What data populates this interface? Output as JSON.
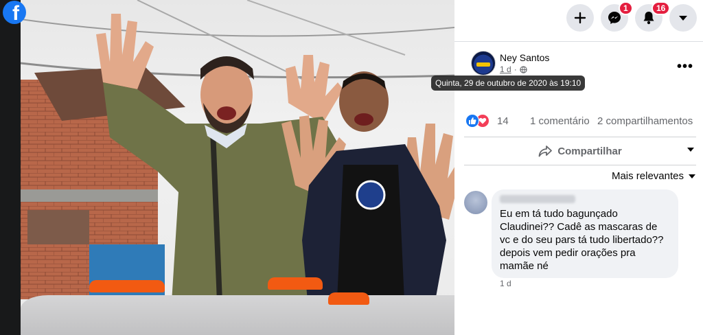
{
  "brand": {
    "logo_letter": "f"
  },
  "topbar": {
    "create_icon": "plus-icon",
    "messenger_badge": "1",
    "notifications_badge": "16",
    "account_icon": "caret-down-icon"
  },
  "post": {
    "author": "Ney Santos",
    "time": "1 d",
    "privacy_icon": "globe-icon",
    "tooltip": "Quinta, 29 de outubro de 2020 às 19:10",
    "more_label": "•••",
    "reactions_count": "14",
    "comments_label": "1 comentário",
    "shares_label": "2 compartilhamentos",
    "share_button": "Compartilhar",
    "sort_label": "Mais relevantes"
  },
  "comment": {
    "text": "Eu em tá tudo bagunçado Claudinei?? Cadê as mascaras de vc e do seu pars tá tudo libertado?? depois vem pedir orações pra mamãe né",
    "time": "1 d"
  },
  "colors": {
    "facebook_blue": "#1877f2",
    "badge_red": "#e41e3f",
    "love_red": "#f33e58",
    "secondary_text": "#65676b"
  }
}
